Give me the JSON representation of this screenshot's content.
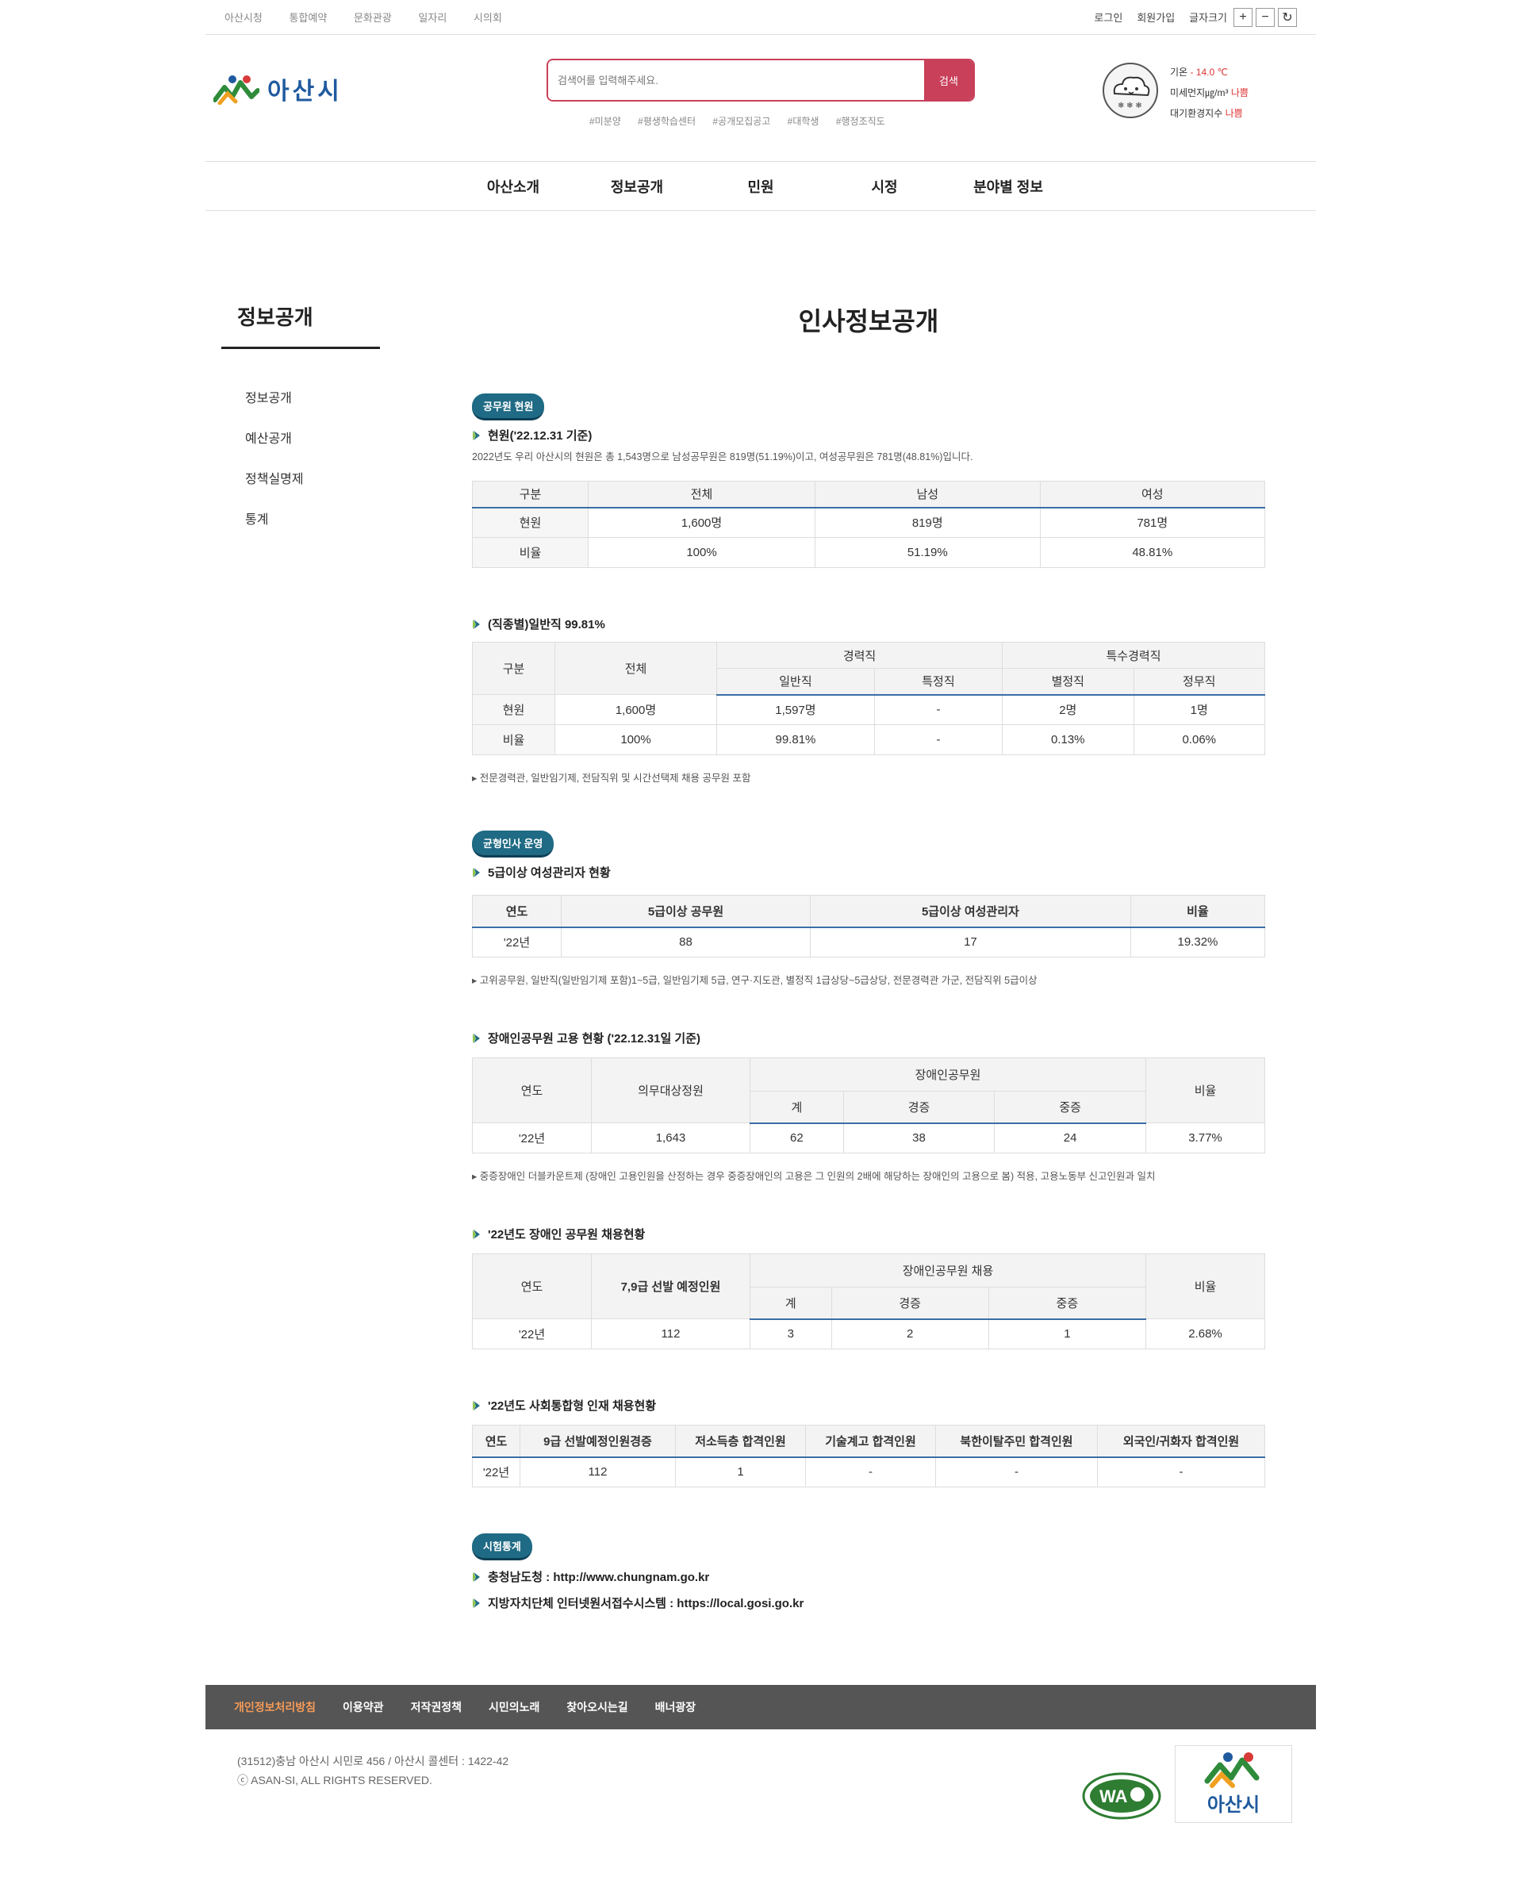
{
  "util": {
    "left": [
      "아산시청",
      "통합예약",
      "문화관광",
      "일자리",
      "시의회"
    ],
    "login": "로그인",
    "join": "회원가입",
    "font_size": "글자크기",
    "plus": "+",
    "minus": "−",
    "reset": "↻"
  },
  "header": {
    "logo_text": "아산시",
    "search_placeholder": "검색어를 입력해주세요.",
    "search_button": "검색",
    "tags": [
      "#미분양",
      "#평생학습센터",
      "#공개모집공고",
      "#대학생",
      "#행정조직도"
    ],
    "weather": {
      "temp_label": "기온",
      "temp_value": "- 14.0 ℃",
      "dust_label": "미세먼지㎍/m³",
      "dust_value": "나쁨",
      "air_label": "대기환경지수",
      "air_value": "나쁨"
    }
  },
  "gnb": [
    "아산소개",
    "정보공개",
    "민원",
    "시정",
    "분야별 정보"
  ],
  "side": {
    "title": "정보공개",
    "items": [
      "정보공개",
      "예산공개",
      "정책실명제",
      "통계"
    ]
  },
  "main": {
    "title": "인사정보공개",
    "badge1": "공무원 현원",
    "s1": {
      "title": "현원('22.12.31 기준)",
      "desc": "2022년도 우리 아산시의 현원은 총 1,543명으로 남성공무원은 819명(51.19%)이고, 여성공무원은 781명(48.81%)입니다.",
      "headers": [
        "구분",
        "전체",
        "남성",
        "여성"
      ],
      "rows": [
        [
          "현원",
          "1,600명",
          "819명",
          "781명"
        ],
        [
          "비율",
          "100%",
          "51.19%",
          "48.81%"
        ]
      ]
    },
    "s2": {
      "title": "(직종별)일반직 99.81%",
      "h_gubun": "구분",
      "h_total": "전체",
      "h_career": "경력직",
      "h_special": "특수경력직",
      "h_sub": [
        "일반직",
        "특정직",
        "별정직",
        "정무직"
      ],
      "rows": [
        [
          "현원",
          "1,600명",
          "1,597명",
          "-",
          "2명",
          "1명"
        ],
        [
          "비율",
          "100%",
          "99.81%",
          "-",
          "0.13%",
          "0.06%"
        ]
      ],
      "note": "▸ 전문경력관, 일반임기제, 전담직위 및 시간선택제 채용 공무원 포함"
    },
    "badge2": "균형인사 운영",
    "s3": {
      "title": "5급이상 여성관리자 현황",
      "headers": [
        "연도",
        "5급이상 공무원",
        "5급이상 여성관리자",
        "비율"
      ],
      "rows": [
        [
          "'22년",
          "88",
          "17",
          "19.32%"
        ]
      ],
      "note": "▸ 고위공무원, 일반직(일반임기제 포함)1~5급, 일반임기제 5급, 연구·지도관, 별정직 1급상당~5급상당, 전문경력관 가군, 전담직위 5급이상"
    },
    "s4": {
      "title": "장애인공무원 고용 현황 ('22.12.31일 기준)",
      "h_year": "연도",
      "h_target": "의무대상정원",
      "h_group": "장애인공무원",
      "h_ratio": "비율",
      "h_sub": [
        "계",
        "경증",
        "중증"
      ],
      "rows": [
        [
          "'22년",
          "1,643",
          "62",
          "38",
          "24",
          "3.77%"
        ]
      ],
      "note": "▸ 중증장애인 더블카운트제 (장애인 고용인원을 산정하는 경우 중증장애인의 고용은 그 인원의 2배에 해당하는 장애인의 고용으로 봄) 적용, 고용노동부 신고인원과 일치"
    },
    "s5": {
      "title": "'22년도 장애인 공무원 채용현황",
      "h_year": "연도",
      "h_target": "7,9급 선발 예정인원",
      "h_group": "장애인공무원 채용",
      "h_ratio": "비율",
      "h_sub": [
        "계",
        "경증",
        "중증"
      ],
      "rows": [
        [
          "'22년",
          "112",
          "3",
          "2",
          "1",
          "2.68%"
        ]
      ]
    },
    "s6": {
      "title": "'22년도 사회통합형 인재 채용현황",
      "headers": [
        "연도",
        "9급 선발예정인원경증",
        "저소득층 합격인원",
        "기술계고 합격인원",
        "북한이탈주민 합격인원",
        "외국인/귀화자 합격인원"
      ],
      "rows": [
        [
          "'22년",
          "112",
          "1",
          "-",
          "-",
          "-"
        ]
      ]
    },
    "badge3": "시험통계",
    "links": [
      "충청남도청 : http://www.chungnam.go.kr",
      "지방자치단체 인터넷원서접수시스템 : https://local.gosi.go.kr"
    ]
  },
  "footer": {
    "menu": [
      "개인정보처리방침",
      "이용약관",
      "저작권정책",
      "시민의노래",
      "찾아오시는길",
      "배너광장"
    ],
    "address": "(31512)충남 아산시 시민로 456 / 아산시 콜센터 : 1422-42",
    "copyright": "ⓒ ASAN-SI, ALL RIGHTS RESERVED.",
    "wa_text": "WA",
    "logo_text": "아산시"
  },
  "colors": {
    "accent": "#c8405a",
    "badge": "#1f6a84",
    "table_line": "#3a6ea5"
  }
}
